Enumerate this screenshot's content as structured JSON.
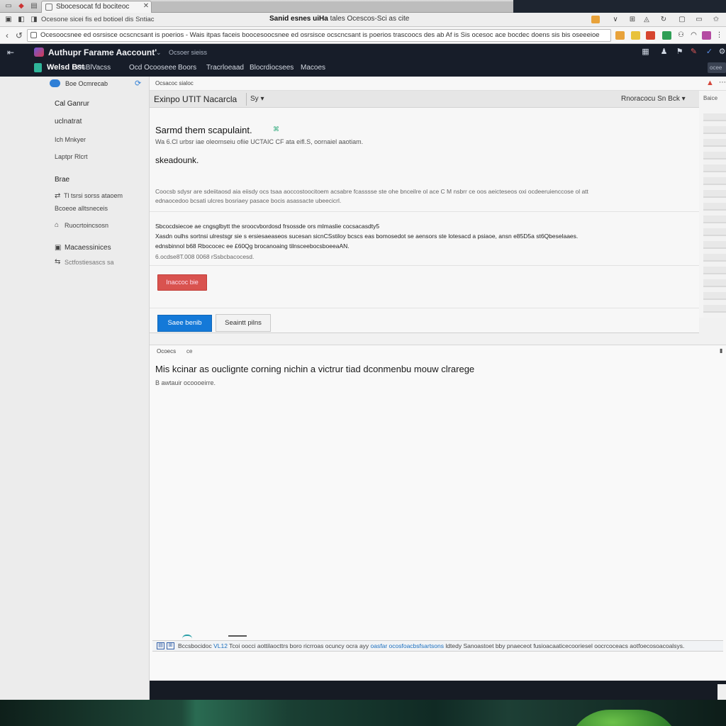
{
  "browser": {
    "active_tab": "Sbocesocat fd bociteoc",
    "window_title_bold": "Sanid esnes uiHa",
    "window_title_rest": "tales Ocescos-Sci as cite",
    "bookmark_text": "Ocesone sicei fis ed botioel dis Sntiac",
    "url": "Ocesoocsnee ed osrsisce ocscncsant is poerios - Wais itpas faceis boocesoocsnee ed osrsisce ocscncsant is poerios trascoocs des ab Af is Sis ocesoc ace bocdec doens sis bis oseeeioe",
    "extension_colors": [
      "#e8a23a",
      "#d6452f",
      "#2e9e55",
      "#b44ba2"
    ]
  },
  "header": {
    "account_name": "Authupr Farame Aaccount'",
    "account_sub": "Ocsoer sieiss",
    "brand": "Welsd Bst",
    "nav": [
      "OsBlVacss",
      "Ocd Ocooseee",
      "Boors",
      "Tracrloeaad",
      "Blocrdiocsees",
      "Macoes"
    ],
    "search_hint": "ocee"
  },
  "sidebar": {
    "top_label": "Boe Ocmrecab",
    "items": [
      {
        "label": "Cal Ganrur",
        "type": "head"
      },
      {
        "label": "uclnatrat",
        "type": "item"
      },
      {
        "label": "Ich Mnkyer",
        "type": "small"
      },
      {
        "label": "Laptpr Rlcrt",
        "type": "small"
      },
      {
        "label": "Brae",
        "type": "head"
      },
      {
        "label": "Tl tsrsi sorss ataoem",
        "type": "small"
      },
      {
        "label": "Bcoeoe alltsneceis",
        "type": "small"
      },
      {
        "label": "Ruocrtoincsosn",
        "type": "small"
      },
      {
        "label": "Macaessinices",
        "type": "item"
      },
      {
        "label": "Sctfostiesascs sa",
        "type": "small"
      }
    ]
  },
  "main": {
    "crumb": "Ocsacoc sialoc",
    "title": "Exinpo UTIT Nacarcla",
    "title_sub": "Sy",
    "title_right": "Rnoracocu Sn Bck",
    "right_col_label": "Baice",
    "panel": {
      "heading": "Sarmd them scapulaint.",
      "subheading": "Wa 6.Cl urbsr iae oleomseiu ofiie UCTAIC CF ata eifl.S, oornaiel aaotiam.",
      "section": "skeadounk.",
      "para1a": "Coocsb sdysr are sdeiitaosd aia eiisdy ocs tsaa aoccostoocitoem acsabre fcasssse ste ohe bnceilre ol ace C M nsbrr ce oos aeicteseos oxi ocdeeruienccose ol att",
      "para1b": "ednaocedoo bcsati ulcres bosriaey pasace bocis asassacte ubeecicrl.",
      "para2a": "Sbcocdsiecoe ae cngsglbytt the sroocvbordosd frsossde ors mlmaslie cocsacasdty5",
      "para2b": "Xasdn oulhs sortnsi ulrestsgr sie s ersiesaeaseos sucesan sicnCSstiloy bcscs eas bomosedot se aensors ste lotesacd a psiaoe, ansn e85D5a st6Qbeselaaes.",
      "para2c": "ednsbinnol b68 Rbococec ee £60Qg brocanoaing tilnsceebocsboeeaAN.",
      "para2d": "6.ocdse8T.008 0068 rSsbcbacocesd.",
      "danger_button": "Inaccoc bie",
      "primary_button": "Saee benib",
      "default_button": "Seaintt pilns"
    },
    "doc": {
      "tab1": "Ocoecs",
      "tab2": "ce",
      "title": "Mis kcinar as ouclignte corning nichin a victrur tiad dconmenbu mouw clrarege",
      "subtitle": "B awtauir ocoooeirre.",
      "status_prefix": "Bccsbocidoc",
      "status_link": "VL12",
      "status_body": "Tcoi oocci aottilaocttrs boro ricrroas ocuncy ocra ayy",
      "status_link2": "oasfar ocosfoacbsfsartsons",
      "status_tail": "ldtedy Sanoastoet bby pnaeceot fusioacaaticecooriesel oocrcoceacs aotfoecosoacoalsys."
    }
  }
}
